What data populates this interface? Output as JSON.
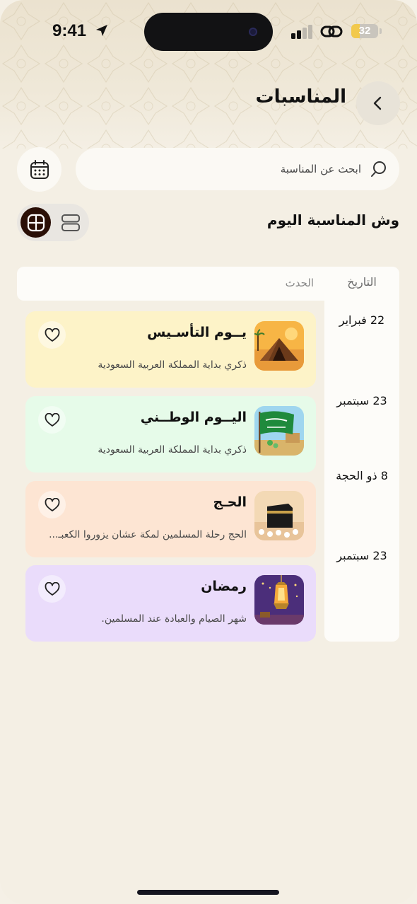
{
  "status_bar": {
    "time": "9:41",
    "battery": "32",
    "battery_level": 0.32
  },
  "header": {
    "title": "المناسبات",
    "back_icon": "chevron-right-icon"
  },
  "search": {
    "placeholder": "ابحث عن المناسبة",
    "icon": "search-icon"
  },
  "calendar_button": {
    "icon": "calendar-icon"
  },
  "today_section": {
    "title": "وش المناسبة اليوم",
    "view_toggle": {
      "selected": "grid",
      "options": [
        "grid-icon",
        "list-icon"
      ]
    }
  },
  "table": {
    "headers": {
      "date": "التاريخ",
      "event": "الحدث"
    },
    "rows": [
      {
        "date": "22 فبراير",
        "title": "يــوم التأسـيس",
        "description": "ذكري بداية المملكة العربية السعودية",
        "color": "#fdf3c8",
        "thumb": "tent-icon"
      },
      {
        "date": "23 سبتمبر",
        "title": "اليــوم الوطــني",
        "description": "ذكري بداية المملكة العربية السعودية",
        "color": "#e6fbe9",
        "thumb": "saudi-flag-icon"
      },
      {
        "date": "8 ذو الحجة",
        "title": "الحـج",
        "description": "الحج رحلة المسلمين لمكة عشان يزوروا الكعبـ...",
        "color": "#fde5d3",
        "thumb": "kaaba-icon"
      },
      {
        "date": "23 سبتمبر",
        "title": "رمضان",
        "description": "شهر الصيام والعبادة عند المسلمين.",
        "color": "#eadcfb",
        "thumb": "lantern-icon"
      }
    ]
  },
  "colors": {
    "background": "#f4efe4",
    "accent_dark": "#2a0f06",
    "battery": "#f2c94c"
  }
}
